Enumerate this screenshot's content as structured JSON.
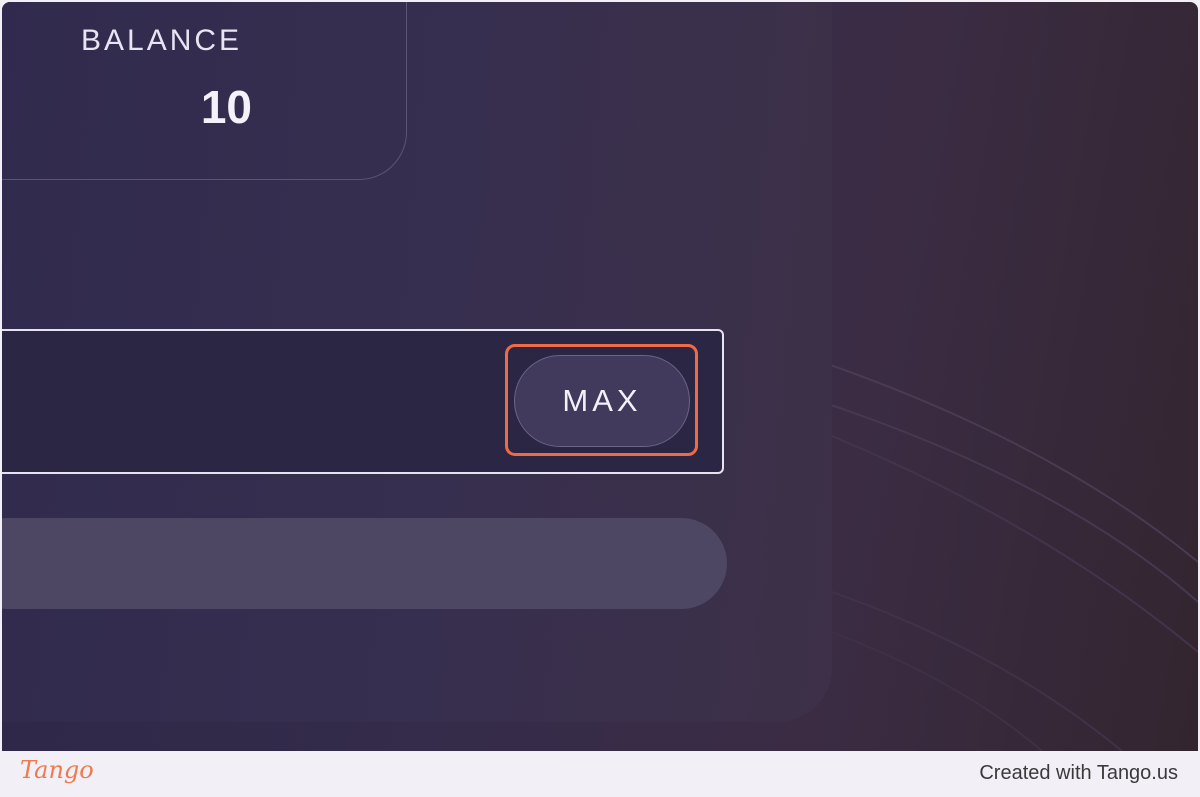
{
  "balance": {
    "label": "BALANCE",
    "value": "10"
  },
  "amount": {
    "value": "",
    "placeholder": ""
  },
  "max_button": {
    "label": "MAX"
  },
  "footer": {
    "logo": "Tango",
    "credit": "Created with Tango.us"
  },
  "colors": {
    "highlight": "#f06b43",
    "background": "#2d2748",
    "card": "#302a4e",
    "logo": "#ef7a4e"
  }
}
